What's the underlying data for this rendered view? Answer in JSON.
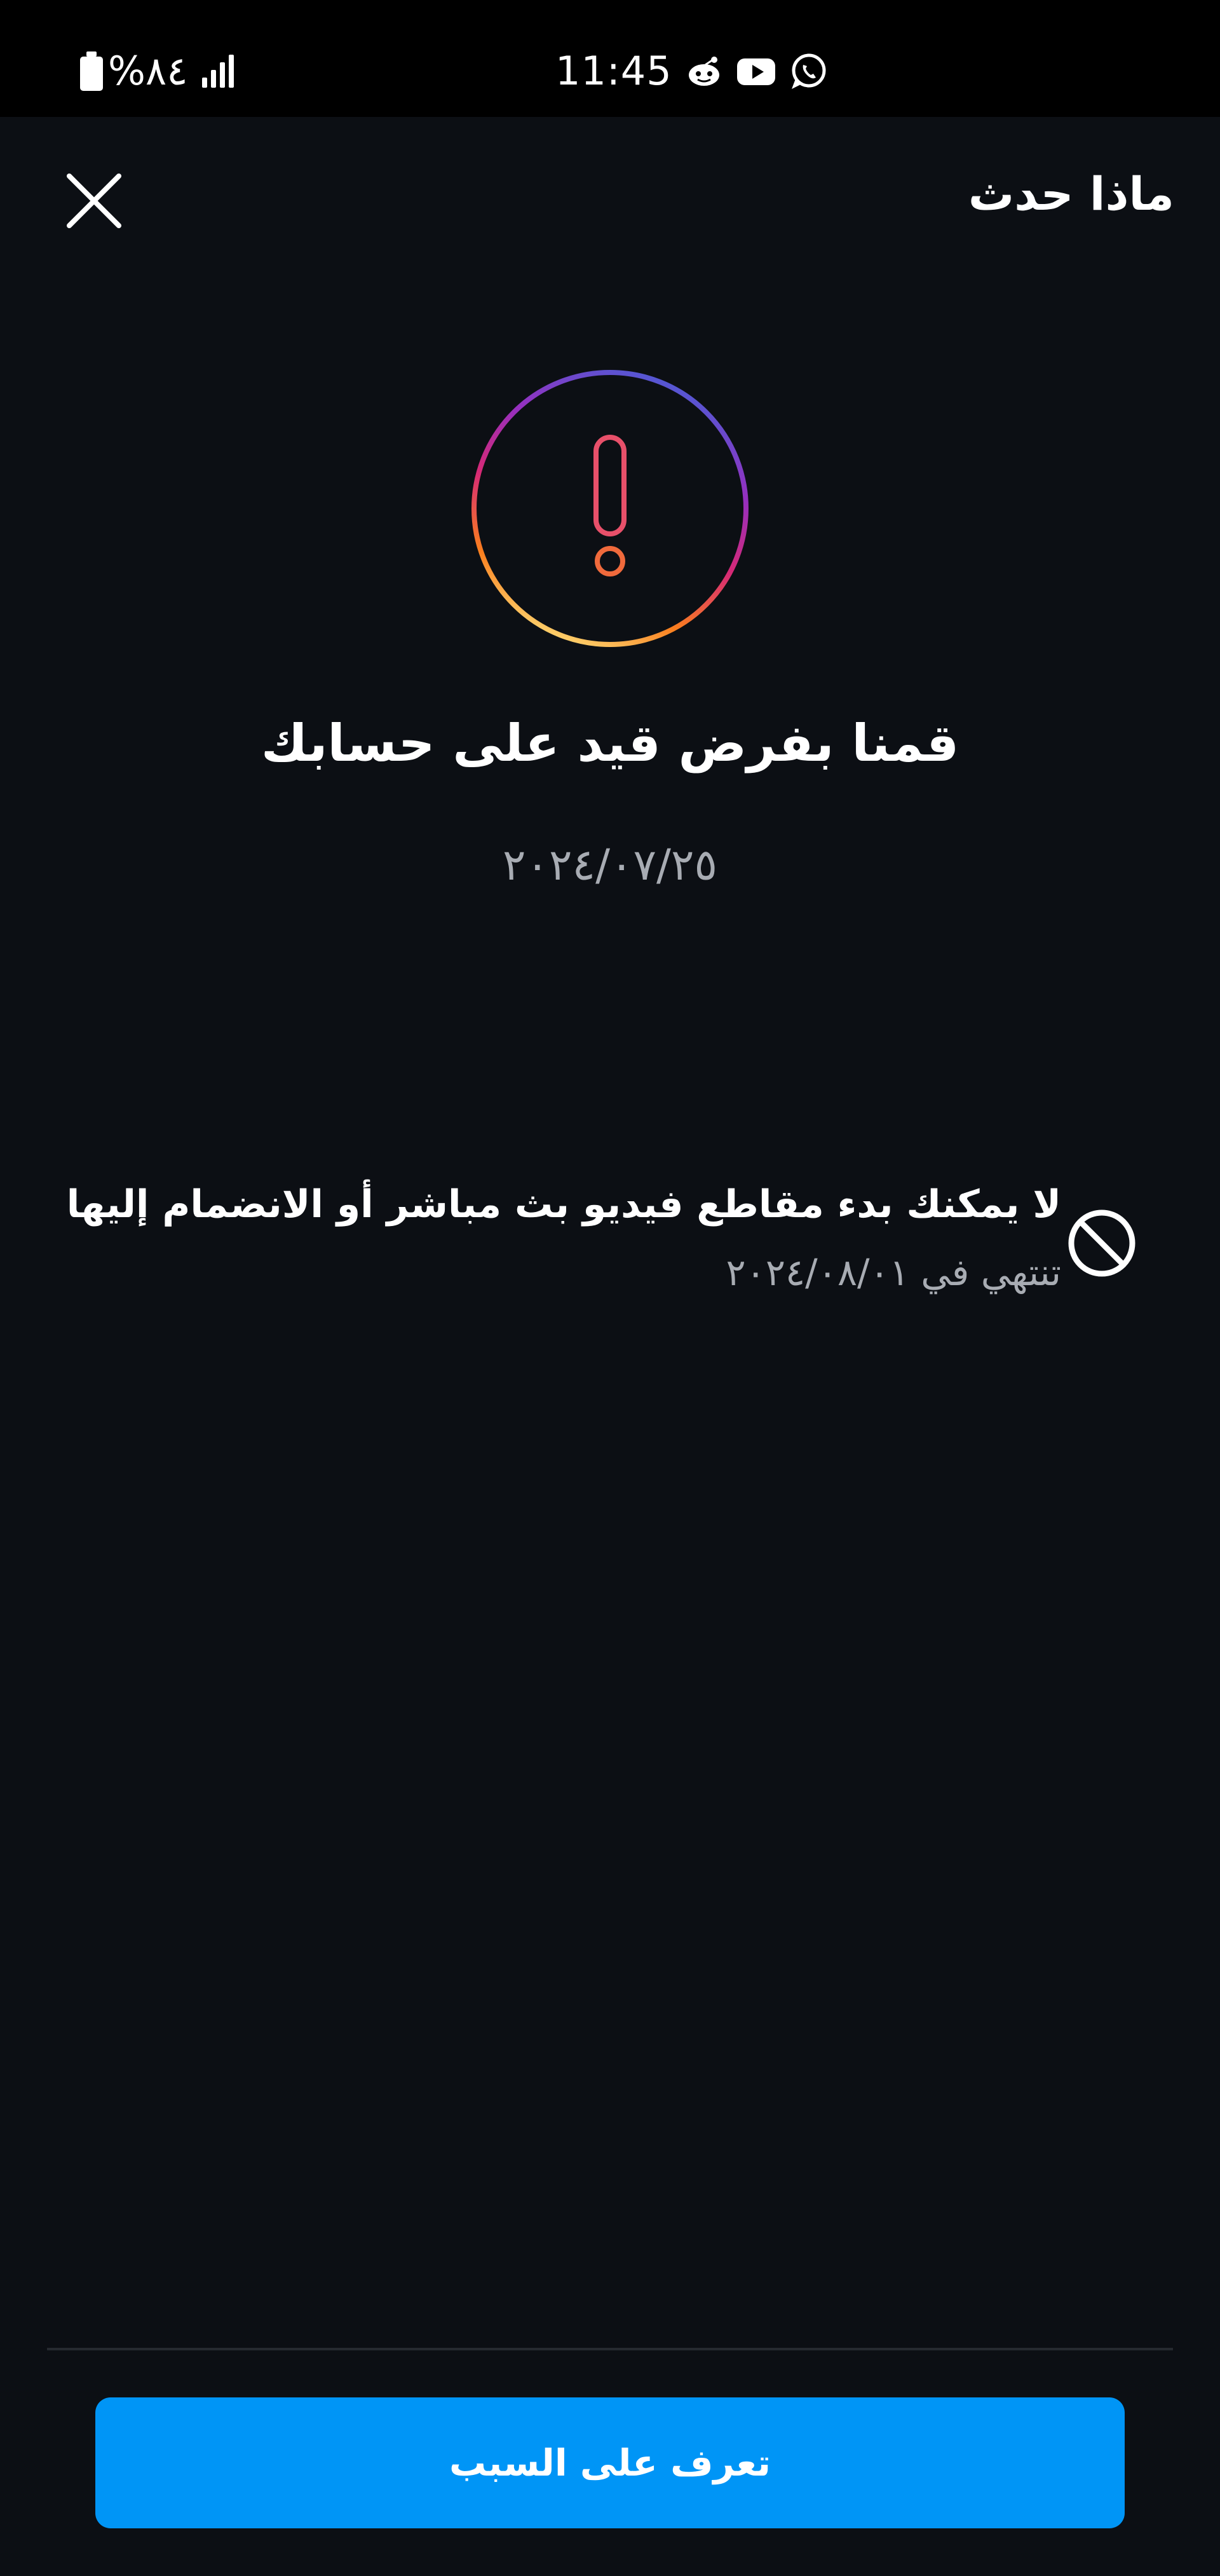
{
  "status_bar": {
    "battery_text": "%٨٤",
    "time": "11:45",
    "icons": [
      "battery-icon",
      "signal-icon",
      "reddit-icon",
      "youtube-icon",
      "whatsapp-icon"
    ]
  },
  "header": {
    "title": "ماذا حدث",
    "close_icon": "close-icon"
  },
  "alert": {
    "icon": "alert-icon",
    "headline": "قمنا بفرض قيد على حسابك",
    "date": "٢٠٢٤/٠٧/٢٥"
  },
  "restriction": {
    "icon": "ban-icon",
    "title": "لا يمكنك بدء مقاطع فيديو بث مباشر أو الانضمام إليها",
    "subtitle": "تنتهي في ٢٠٢٤/٠٨/٠١"
  },
  "footer": {
    "button_label": "تعرف على السبب"
  },
  "colors": {
    "background": "#0c0f14",
    "accent": "#0095f6",
    "secondary_text": "#a8acb3",
    "gradient": [
      "#4f5bd5",
      "#962fbf",
      "#d62976",
      "#fa7e1e",
      "#feda75"
    ]
  }
}
